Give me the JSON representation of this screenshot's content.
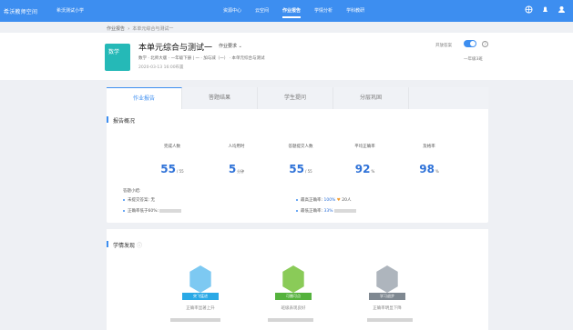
{
  "app": {
    "brand": "希沃教师空间",
    "school": "希沃测试小学",
    "nav": [
      "资源中心",
      "云空间",
      "作业报告",
      "学情分析",
      "学科教研"
    ]
  },
  "breadcrumb": [
    "作业报告",
    "本单元综合与测试一"
  ],
  "header": {
    "book_label": "数学",
    "title": "本单元综合与测试一",
    "requirement": "作业要求",
    "meta": "数学 · 北师大版 · 一年级下册    |   一 · 加与减（一）   ·   本单元综合与测试",
    "time": "2020-03-13 16:00布置",
    "toggle_label": "开放答案",
    "grade": "一年级3班"
  },
  "tabs": [
    "作业报告",
    "答题结果",
    "学生提问",
    "分层巩固"
  ],
  "overview": {
    "title": "报告概况",
    "stats": [
      {
        "label": "完成人数",
        "value": "55",
        "suffix": "/ 55"
      },
      {
        "label": "人均用时",
        "value": "5",
        "suffix": "分钟"
      },
      {
        "label": "答题提交人数",
        "value": "55",
        "suffix": "/ 55"
      },
      {
        "label": "平均正确率",
        "value": "92",
        "suffix": "%"
      },
      {
        "label": "及格率",
        "value": "98",
        "suffix": "%"
      }
    ],
    "summary_title": "答题小结:",
    "items": {
      "not_submitted": "未提交答案: 无",
      "accuracy_below": "正确率低于60%:",
      "highest": "最高正确率:",
      "highest_value": "100%",
      "highest_people": "20人",
      "lowest": "最低正确率:",
      "lowest_value": "33%"
    }
  },
  "findings": {
    "title": "学情发现",
    "badges": [
      {
        "label": "突飞猛进",
        "caption": "正确率显著上升"
      },
      {
        "label": "可圈可点",
        "caption": "班级表现良好"
      },
      {
        "label": "学习退步",
        "caption": "正确率明显下降"
      }
    ]
  },
  "colors": {
    "primary": "#3d8ef0",
    "book": "#25b9b7",
    "stats": "#2f72d8"
  }
}
